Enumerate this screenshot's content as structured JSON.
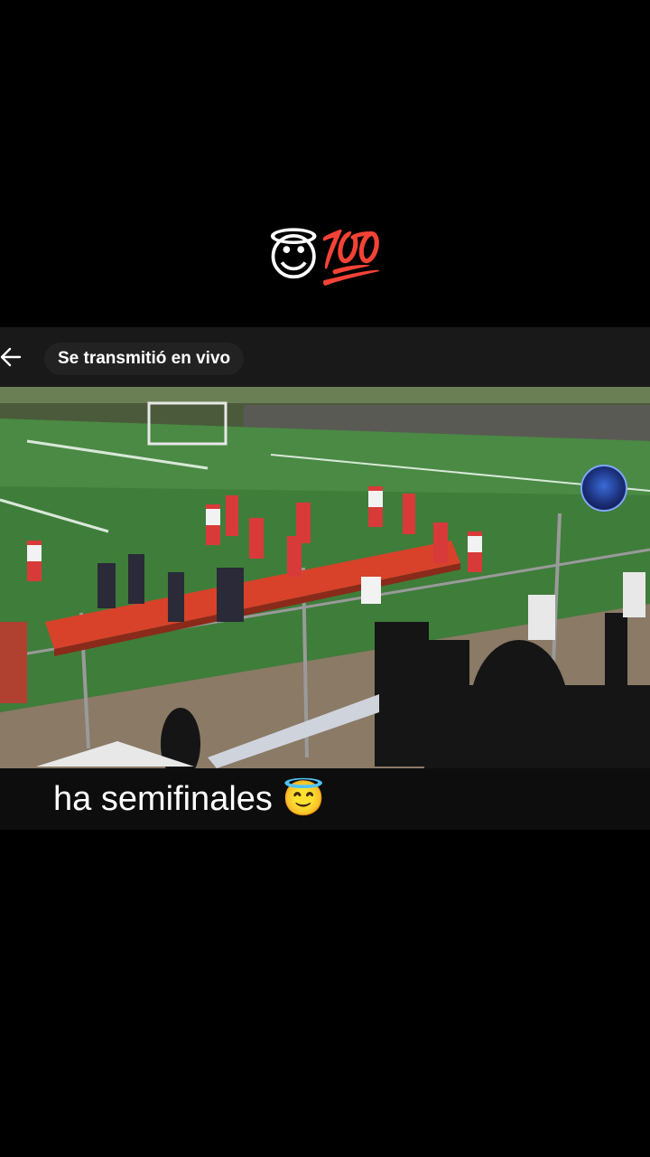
{
  "top_caption": "😇💯",
  "embed": {
    "live_label": "Se transmitió en vivo",
    "back_icon": "arrow-left-icon",
    "channel_logo_icon": "channel-logo-icon"
  },
  "video": {
    "scene": "soccer-field-celebration"
  },
  "bottom_caption": "ha semifinales 😇"
}
